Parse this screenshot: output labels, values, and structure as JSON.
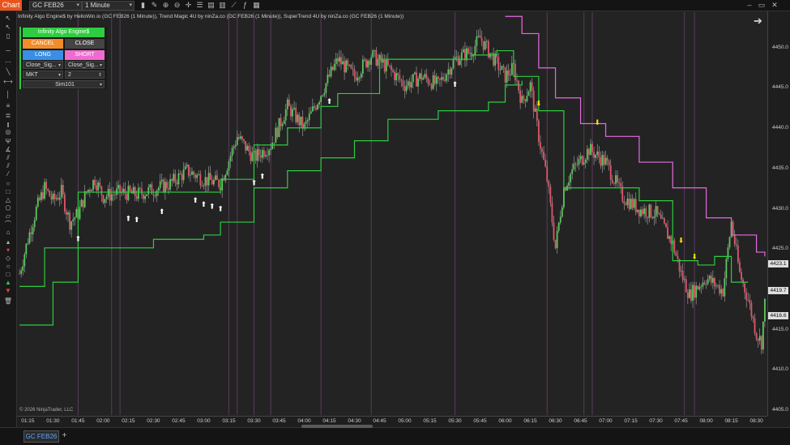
{
  "toolbar": {
    "chart_tab": "Chart",
    "instrument": "GC FEB26",
    "timeframe": "1 Minute",
    "icons": [
      "bar-type-icon",
      "draw-icon",
      "zoom-in-icon",
      "zoom-out-icon",
      "crosshair-icon",
      "properties-icon",
      "template-icon",
      "data-box-icon",
      "strategies-icon",
      "indicators-icon",
      "chart-trader-icon"
    ],
    "window_buttons": [
      "minimize-icon",
      "maximize-icon",
      "close-icon"
    ]
  },
  "caption": "Infinity Algo Engine$ by HelloWin.io (GC FEB26 (1 Minute)), Trend Magic 4U by ninZa.co (GC FEB26 (1 Minute)), SuperTrend 4U by ninZa.co (GC FEB26 (1 Minute))",
  "copyright": "© 2026 NinjaTrader, LLC",
  "panel": {
    "title": "Infinity Algo Engine$",
    "cancel": "CANCEL",
    "close": "CLOSE",
    "long": "LONG",
    "short": "SHORT",
    "exit_left": "Close_Sig...",
    "exit_right": "Close_Sig...",
    "order_type": "MKT",
    "quantity": "2",
    "account": "Sim101",
    "colors": {
      "title": "#2ecc40",
      "cancel": "#f28c28",
      "close": "#444444",
      "long": "#3a8ee6",
      "short": "#f06bd0"
    }
  },
  "y_axis": {
    "ticks": [
      "4450.0",
      "4445.0",
      "4440.0",
      "4435.0",
      "4430.0",
      "4425.0",
      "4420.0",
      "4415.0",
      "4410.0",
      "4405.0"
    ],
    "badges": [
      {
        "label": "4423.1",
        "value": 4423.1
      },
      {
        "label": "4419.7",
        "value": 4419.7
      },
      {
        "label": "4416.6",
        "value": 4416.6
      }
    ]
  },
  "x_axis": {
    "ticks": [
      "01:15",
      "01:30",
      "01:45",
      "02:00",
      "02:15",
      "02:30",
      "02:45",
      "03:00",
      "03:15",
      "03:30",
      "03:45",
      "04:00",
      "04:15",
      "04:30",
      "04:45",
      "05:00",
      "05:15",
      "05:30",
      "05:45",
      "06:00",
      "06:15",
      "06:30",
      "06:45",
      "07:00",
      "07:15",
      "07:30",
      "07:45",
      "08:00",
      "08:15",
      "08:30"
    ]
  },
  "bottom": {
    "tab": "GC FEB26",
    "add": "+"
  },
  "chart_data": {
    "type": "candlestick",
    "instrument": "GC FEB26",
    "ylim": [
      4404.5,
      4451.5
    ],
    "x_range": [
      "01:09",
      "08:36"
    ],
    "series": [
      {
        "x": [
          "01:10",
          "01:15",
          "01:20",
          "01:25",
          "01:30",
          "01:35",
          "01:40",
          "01:45",
          "01:50",
          "01:55",
          "02:00",
          "02:10",
          "02:20",
          "02:30",
          "02:40",
          "02:50",
          "03:00",
          "03:10",
          "03:20",
          "03:30",
          "03:40",
          "03:50",
          "04:00",
          "04:10",
          "04:20",
          "04:30",
          "04:40",
          "04:50",
          "05:00",
          "05:10",
          "05:20",
          "05:30",
          "05:40",
          "05:45",
          "05:50",
          "06:00",
          "06:05",
          "06:10",
          "06:15",
          "06:20",
          "06:25",
          "06:30",
          "06:35",
          "06:40",
          "06:50",
          "07:00",
          "07:10",
          "07:20",
          "07:30",
          "07:40",
          "07:45",
          "07:50",
          "08:00",
          "08:10",
          "08:15",
          "08:20",
          "08:25",
          "08:30",
          "08:33",
          "08:35"
        ],
        "close": [
          4421.0,
          4425.0,
          4428.5,
          4431.0,
          4429.5,
          4430.5,
          4427.0,
          4428.0,
          4430.5,
          4432.0,
          4430.0,
          4430.5,
          4430.2,
          4430.8,
          4431.5,
          4433.0,
          4432.0,
          4431.5,
          4437.0,
          4434.5,
          4436.0,
          4440.5,
          4438.0,
          4442.0,
          4446.0,
          4444.0,
          4446.5,
          4445.0,
          4443.0,
          4444.0,
          4443.0,
          4446.0,
          4447.0,
          4448.5,
          4447.0,
          4444.0,
          4445.0,
          4441.0,
          4443.0,
          4437.0,
          4432.0,
          4424.0,
          4431.0,
          4433.0,
          4435.5,
          4434.0,
          4430.0,
          4428.5,
          4428.0,
          4424.5,
          4421.0,
          4418.5,
          4420.5,
          4419.0,
          4427.0,
          4421.0,
          4418.0,
          4414.0,
          4413.0,
          4417.5
        ]
      },
      {
        "name": "Trend Magic",
        "color": "#2ecc40",
        "x": [
          "01:10",
          "01:25",
          "01:45",
          "02:00",
          "02:55",
          "03:10",
          "03:30",
          "03:50",
          "04:10",
          "04:20",
          "04:45",
          "05:40",
          "05:55",
          "06:05",
          "06:20",
          "06:35",
          "07:00",
          "07:20",
          "07:40",
          "07:55",
          "08:05",
          "08:15",
          "08:25"
        ],
        "y": [
          4419.5,
          4424.0,
          4430.5,
          4430.5,
          4430.5,
          4432.0,
          4436.0,
          4438.0,
          4440.5,
          4442.0,
          4446.0,
          4446.5,
          4447.0,
          4444.0,
          4440.0,
          4431.0,
          4431.0,
          4429.5,
          4422.5,
          4422.0,
          4423.0,
          4420.0,
          4420.0
        ]
      },
      {
        "name": "SuperTrend",
        "color": "#2ecc40",
        "x": [
          "01:10",
          "01:30",
          "01:45",
          "02:30",
          "03:00",
          "03:10",
          "03:30",
          "03:50",
          "04:10",
          "04:30",
          "04:50",
          "05:20",
          "05:50",
          "06:00",
          "06:10"
        ],
        "y": [
          4415.0,
          4420.0,
          4424.0,
          4425.0,
          4425.5,
          4427.0,
          4431.0,
          4433.0,
          4434.5,
          4436.5,
          4439.0,
          4440.0,
          4441.0,
          4443.0,
          4443.5
        ]
      },
      {
        "name": "SuperTrend (bearish)",
        "color": "#e76ae0",
        "x": [
          "06:00",
          "06:10",
          "06:20",
          "06:30",
          "06:45",
          "07:00",
          "07:20",
          "07:40",
          "08:00",
          "08:15",
          "08:30",
          "08:35"
        ],
        "y": [
          4451.0,
          4449.0,
          4445.0,
          4441.5,
          4438.5,
          4437.0,
          4434.0,
          4431.0,
          4427.5,
          4425.5,
          4423.5,
          4423.0
        ]
      }
    ],
    "buy_signals": [
      "01:45",
      "02:15",
      "02:20",
      "02:35",
      "02:55",
      "03:00",
      "03:05",
      "03:10",
      "03:30",
      "03:35",
      "04:15",
      "05:30"
    ],
    "sell_signals": [
      "06:20",
      "06:55",
      "07:45",
      "07:53"
    ],
    "grid": false,
    "session_lines": [
      "01:45",
      "02:05",
      "02:10",
      "03:15",
      "03:20",
      "03:30",
      "03:40",
      "04:10",
      "04:40",
      "05:30",
      "06:25",
      "06:47",
      "06:52",
      "07:47",
      "07:53"
    ]
  }
}
